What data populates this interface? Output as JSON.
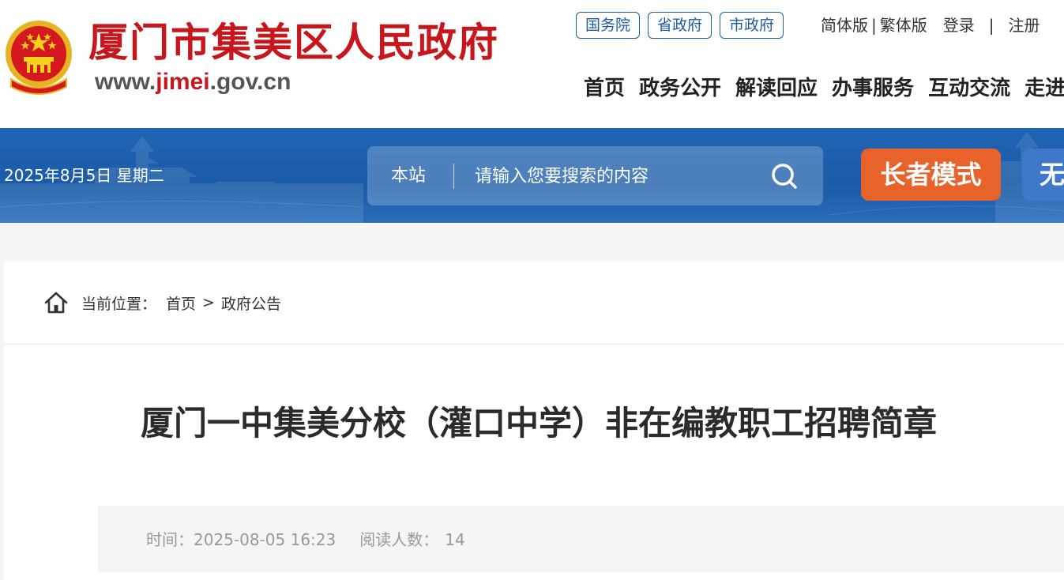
{
  "header": {
    "site_title": "厦门市集美区人民政府",
    "site_url_prefix": "www.",
    "site_url_highlight": "jimei",
    "site_url_suffix": ".gov.cn",
    "gov_links": [
      "国务院",
      "省政府",
      "市政府"
    ],
    "lang_simplified": "简体版",
    "lang_separator": "|",
    "lang_traditional": "繁体版",
    "login": "登录",
    "account_separator": "|",
    "register": "注册",
    "nav": [
      "首页",
      "政务公开",
      "解读回应",
      "办事服务",
      "互动交流",
      "走进集美"
    ]
  },
  "band": {
    "date": "2025年8月5日 星期二",
    "search_scope": "本站",
    "search_placeholder": "请输入您要搜索的内容",
    "elder_mode": "长者模式",
    "accessibility": "无障碍"
  },
  "breadcrumb": {
    "label": "当前位置：",
    "home": "首页",
    "separator": ">",
    "current": "政府公告"
  },
  "article": {
    "title": "厦门一中集美分校（灌口中学）非在编教职工招聘简章",
    "time_label": "时间：",
    "time_value": "2025-08-05 16:23",
    "views_label": "阅读人数：",
    "views_value": "14"
  },
  "colors": {
    "brand_red": "#c8161d",
    "band_blue": "#1b5ba7",
    "elder_orange": "#e8632c",
    "link_blue": "#1f5aa6"
  }
}
